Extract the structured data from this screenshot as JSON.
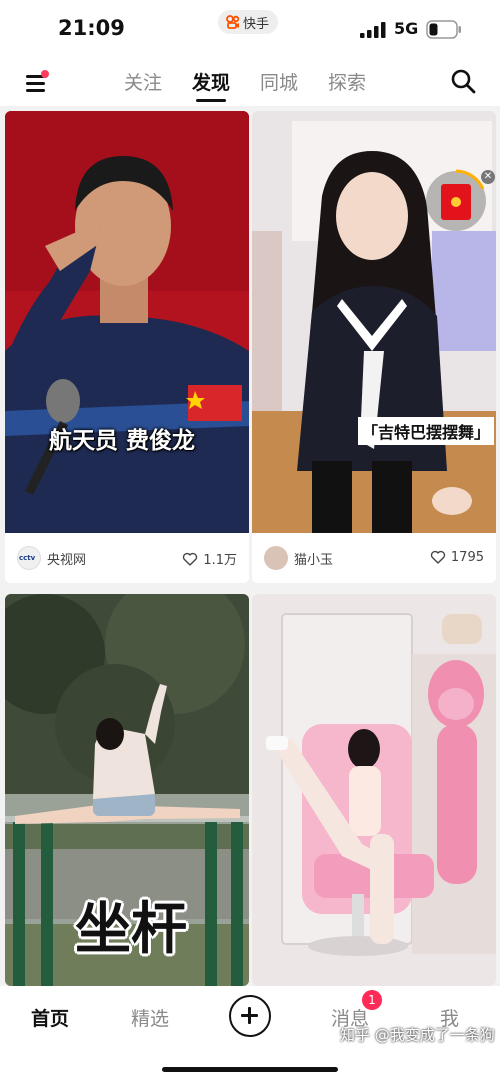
{
  "status_bar": {
    "time": "21:09",
    "app_name": "快手",
    "network": "5G"
  },
  "top_nav": {
    "tabs": [
      {
        "label": "关注",
        "active": false
      },
      {
        "label": "发现",
        "active": true
      },
      {
        "label": "同城",
        "active": false
      },
      {
        "label": "探索",
        "active": false
      }
    ],
    "menu_icon": "menu-icon",
    "search_icon": "search-icon"
  },
  "feed": {
    "cards": [
      {
        "caption": "航天员 费俊龙",
        "author": "央视网",
        "likes": "1.1万",
        "avatar_text": "cctv"
      },
      {
        "caption": "「吉特巴摆摆舞」",
        "author": "猫小玉",
        "likes": "1795"
      },
      {
        "caption": "坐杆"
      },
      {
        "caption": ""
      }
    ]
  },
  "bottom_nav": {
    "items": [
      {
        "label": "首页",
        "active": true
      },
      {
        "label": "精选",
        "active": false
      },
      {
        "label": "消息",
        "active": false,
        "badge": "1"
      },
      {
        "label": "我",
        "active": false
      }
    ]
  },
  "watermark": "知乎 @我变成了一条狗",
  "colors": {
    "accent": "#ff2a55",
    "kuaishou_orange": "#ff5000",
    "background": "#f2f2f2"
  }
}
